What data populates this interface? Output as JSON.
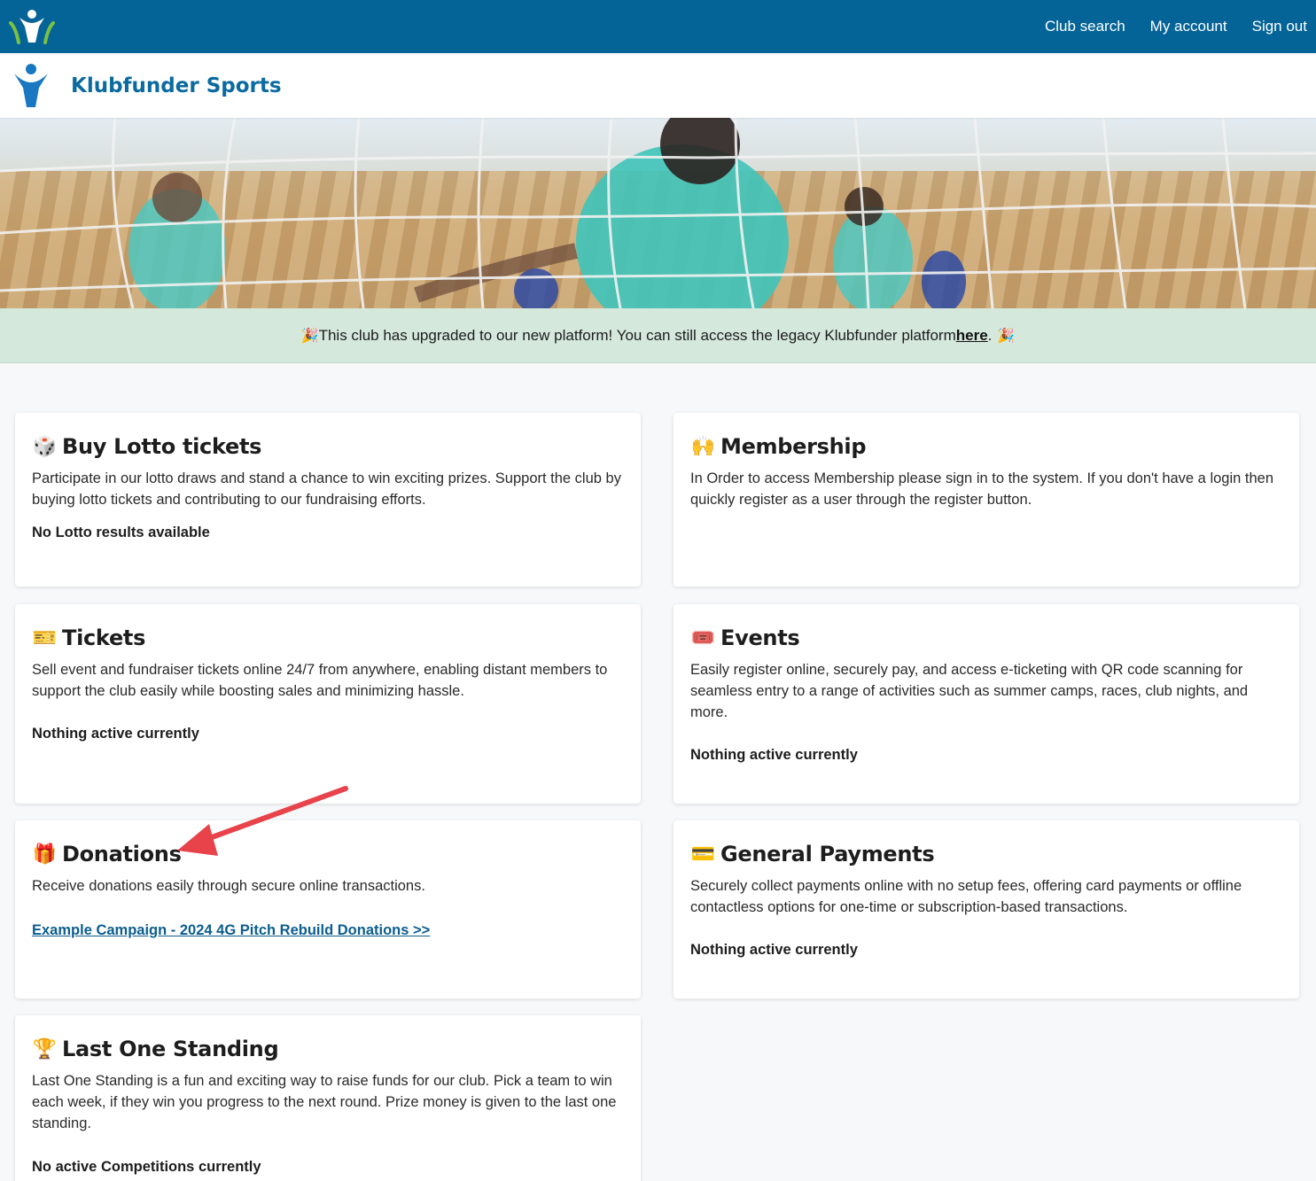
{
  "topbar": {
    "nav": [
      "Club search",
      "My account",
      "Sign out"
    ]
  },
  "club": {
    "name": "Klubfunder Sports"
  },
  "banner": {
    "text_before": "This club has upgraded to our new platform! You can still access the legacy Klubfunder platform ",
    "link_text": "here",
    "text_after": ".",
    "icon": "party-popper-icon"
  },
  "cards": {
    "lotto": {
      "title": "Buy Lotto tickets",
      "icon": "dice-icon",
      "description": "Participate in our lotto draws and stand a chance to win exciting prizes. Support the club by buying lotto tickets and contributing to our fundraising efforts.",
      "status": "No Lotto results available"
    },
    "membership": {
      "title": "Membership",
      "icon": "people-icon",
      "description": "In Order to access Membership please sign in to the system. If you don't have a login then quickly register as a user through the register button."
    },
    "tickets": {
      "title": "Tickets",
      "icon": "ticket-icon",
      "description": "Sell event and fundraiser tickets online 24/7 from anywhere, enabling distant members to support the club easily while boosting sales and minimizing hassle.",
      "status": "Nothing active currently"
    },
    "events": {
      "title": "Events",
      "icon": "admission-ticket-icon",
      "description": "Easily register online, securely pay, and access e-ticketing with QR code scanning for seamless entry to a range of activities such as summer camps, races, club nights, and more.",
      "status": "Nothing active currently"
    },
    "donations": {
      "title": "Donations",
      "icon": "gift-icon",
      "description": "Receive donations easily through secure online transactions.",
      "link": "Example Campaign - 2024 4G Pitch Rebuild Donations >>"
    },
    "payments": {
      "title": "General Payments",
      "icon": "credit-card-icon",
      "description": "Securely collect payments online with no setup fees, offering card payments or offline contactless options for one-time or subscription-based transactions.",
      "status": "Nothing active currently"
    },
    "los": {
      "title": "Last One Standing",
      "icon": "trophy-icon",
      "description": "Last One Standing is a fun and exciting way to raise funds for our club. Pick a team to win each week, if they win you progress to the next round. Prize money is given to the last one standing.",
      "status": "No active Competitions currently"
    }
  },
  "colors": {
    "topbar": "#046498",
    "club_title": "#0b6aa0",
    "banner": "#d5e8dc",
    "arrow": "#e8434b"
  }
}
